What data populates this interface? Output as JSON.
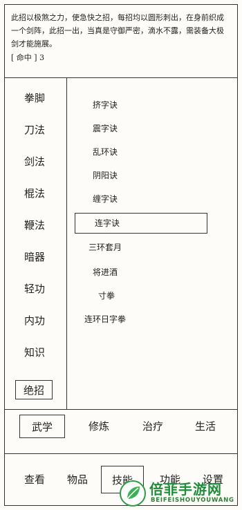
{
  "description": {
    "text": "此招以极煞之力，使急快之招，每招均以圆形刺出，在身前织成一个剑阵，此招一出，当真是守御严密，滴水不露，需装备大极剑才能施展。",
    "tag": "[ 命中 ] 3"
  },
  "categories": [
    {
      "label": "拳脚",
      "selected": false
    },
    {
      "label": "刀法",
      "selected": false
    },
    {
      "label": "剑法",
      "selected": false
    },
    {
      "label": "棍法",
      "selected": false
    },
    {
      "label": "鞭法",
      "selected": false
    },
    {
      "label": "暗器",
      "selected": false
    },
    {
      "label": "轻功",
      "selected": false
    },
    {
      "label": "内功",
      "selected": false
    },
    {
      "label": "知识",
      "selected": false
    },
    {
      "label": "绝招",
      "selected": true
    }
  ],
  "skills": [
    {
      "label": "挤字诀",
      "selected": false
    },
    {
      "label": "震字诀",
      "selected": false
    },
    {
      "label": "乱环诀",
      "selected": false
    },
    {
      "label": "阴阳诀",
      "selected": false
    },
    {
      "label": "缠字诀",
      "selected": false
    },
    {
      "label": "连字诀",
      "selected": true
    },
    {
      "label": "三环套月",
      "selected": false
    },
    {
      "label": "将进酒",
      "selected": false
    },
    {
      "label": "寸拳",
      "selected": false
    },
    {
      "label": "连环日字拳",
      "selected": false
    }
  ],
  "mid_tabs": [
    {
      "label": "武学",
      "selected": true
    },
    {
      "label": "修炼",
      "selected": false
    },
    {
      "label": "治疗",
      "selected": false
    },
    {
      "label": "生活",
      "selected": false
    }
  ],
  "bottom_tabs": [
    {
      "label": "查看",
      "selected": false
    },
    {
      "label": "物品",
      "selected": false
    },
    {
      "label": "技能",
      "selected": true
    },
    {
      "label": "功能",
      "selected": false
    },
    {
      "label": "设置",
      "selected": false
    }
  ],
  "watermark": {
    "title": "倍菲手游网",
    "subtitle": "BEIFEISHOUYOUWANG"
  }
}
